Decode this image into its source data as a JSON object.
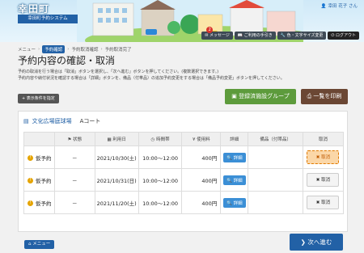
{
  "header": {
    "town": "幸田町",
    "system": "幸田町予約システム",
    "user": "幸田 花子 さん",
    "buttons": [
      {
        "label": "メッセージ",
        "badge": "2"
      },
      {
        "label": "ご利用の手引き"
      },
      {
        "label": "色・文字サイズ変更"
      },
      {
        "label": "ログアウト"
      }
    ]
  },
  "breadcrumb": [
    "メニュー",
    "予約確認",
    "予約取消確認",
    "予約取消完了"
  ],
  "page_title": "予約内容の確認・取消",
  "description": [
    "予約の取消を行う場合は「取消」ボタンを選択し、「次へ進む」ボタンを押してください。(複数選択できます。)",
    "予約内容や納付状況を確認する場合は「詳細」ボタンを、備品（付帯品）の追加予約変更をする場合は「備品予約変更」ボタンを押してください。"
  ],
  "toolbar": {
    "filter": "表示条件を指定",
    "registered": "登録済施設グループ",
    "print": "一覧を印刷"
  },
  "facility": {
    "name": "文化広場庭球場",
    "room": "Aコート"
  },
  "table": {
    "headers": [
      "状態",
      "利用日",
      "時間帯",
      "使用料",
      "詳細",
      "備品（付帯品）",
      "取消"
    ],
    "rows": [
      {
        "status": "仮予約",
        "dash": "－",
        "date": "2021/10/30(土)",
        "time": "10:00～12:00",
        "price": "400円",
        "detail": "詳細",
        "equipment": "",
        "cancel": "取消",
        "selected": true
      },
      {
        "status": "仮予約",
        "dash": "－",
        "date": "2021/10/31(日)",
        "time": "10:00～12:00",
        "price": "400円",
        "detail": "詳細",
        "equipment": "",
        "cancel": "取消",
        "selected": false
      },
      {
        "status": "仮予約",
        "dash": "－",
        "date": "2021/11/20(土)",
        "time": "10:00～12:00",
        "price": "400円",
        "detail": "詳細",
        "equipment": "",
        "cancel": "取消",
        "selected": false
      }
    ]
  },
  "footer": {
    "menu": "メニュー",
    "next": "次へ進む"
  },
  "colors": {
    "primary": "#2261a6",
    "green": "#5d9b3c",
    "brown": "#6b4734",
    "selected_cancel": "#fbd7a8"
  }
}
